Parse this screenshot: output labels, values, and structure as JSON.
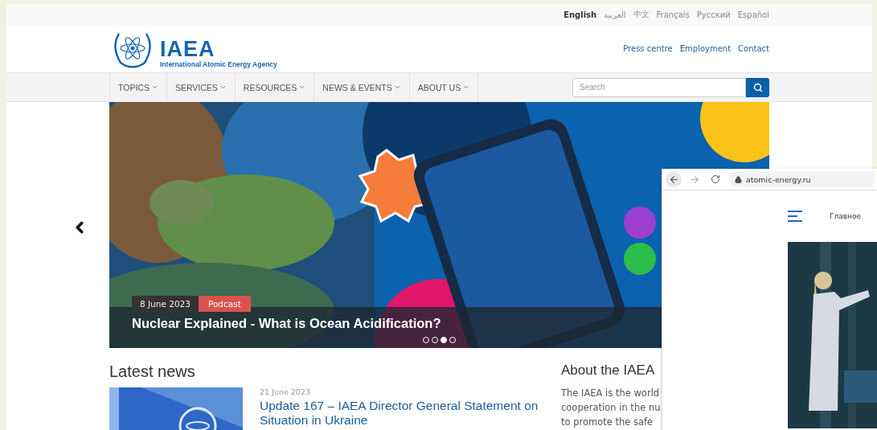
{
  "language_bar": {
    "languages": [
      {
        "label": "English",
        "selected": true
      },
      {
        "label": "العربية",
        "selected": false
      },
      {
        "label": "中文",
        "selected": false
      },
      {
        "label": "Français",
        "selected": false
      },
      {
        "label": "Русский",
        "selected": false
      },
      {
        "label": "Español",
        "selected": false
      }
    ]
  },
  "header": {
    "logo": {
      "acronym": "IAEA",
      "name": "International Atomic Energy Agency"
    },
    "links": [
      "Press centre",
      "Employment",
      "Contact"
    ]
  },
  "nav": {
    "items": [
      "TOPICS",
      "SERVICES",
      "RESOURCES",
      "NEWS & EVENTS",
      "ABOUT US"
    ],
    "search": {
      "placeholder": "Search"
    }
  },
  "carousel": {
    "slide": {
      "kind": "picture",
      "date": "8 June 2023",
      "tag": "Podcast",
      "title": "Nuclear Explained - What is Ocean Acidification?"
    },
    "dots": [
      {
        "selected": false
      },
      {
        "selected": false
      },
      {
        "selected": true
      },
      {
        "selected": false
      }
    ]
  },
  "latest_news": {
    "heading": "Latest news",
    "items": [
      {
        "kind": "picture",
        "date": "21 June 2023",
        "title": "Update 167 – IAEA Director General Statement on Situation in Ukraine"
      }
    ]
  },
  "about": {
    "heading": "About the IAEA",
    "lines": [
      "The IAEA is the world",
      "cooperation in the nu",
      "to promote the safe"
    ]
  },
  "browser_window": {
    "url": "atomic-energy.ru",
    "nav_label": "Главное",
    "kind": "picture"
  }
}
